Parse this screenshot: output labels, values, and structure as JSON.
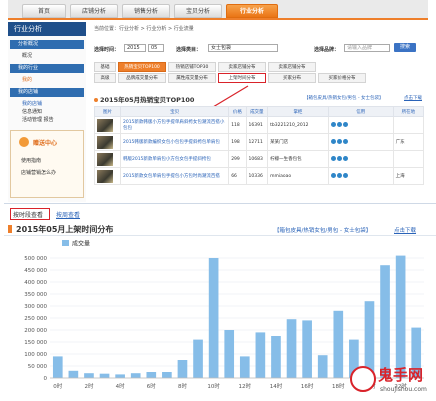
{
  "top_tabs": [
    "首页",
    "店铺分析",
    "销售分析",
    "宝贝分析",
    "行业分析"
  ],
  "active_top_tab": 4,
  "sidebar": {
    "header": "行业分析",
    "sections": [
      {
        "title": "分析概况",
        "items": [
          "概况"
        ]
      },
      {
        "title": "我的行业",
        "items": [
          "我的"
        ]
      },
      {
        "title": "我的店铺",
        "items": [
          "我的店铺",
          "信息通知",
          "活动管理 报告"
        ]
      }
    ],
    "service": {
      "title": "赠送中心",
      "items": [
        "使用指南",
        "店铺营销怎么办"
      ]
    }
  },
  "breadcrumb": "当前位置：行业分析 > 行业分析 > 行业流量",
  "filters": {
    "time_label": "选择时间：",
    "time_value": "2015",
    "month_value": "05",
    "category_label": "选择类目：",
    "category_value": "女士包袋",
    "brand_label": "选择品牌：",
    "brand_placeholder": "请输入品牌",
    "search_button": "搜索"
  },
  "subtabs_row1": [
    "热销宝贝TOP100",
    "热销店铺TOP30",
    "卖家店铺分布",
    "卖家店铺分布"
  ],
  "subtabs_row2": [
    "品牌成交量分布",
    "属性成交量分布",
    "上架时间分布",
    "买家分布",
    "买家价格分布"
  ],
  "section_title": "2015年05月热销宝贝TOP100",
  "section_links": "【箱包皮具/热销女包/男包 - 女士包袋】",
  "section_download": "点击下载",
  "table": {
    "headers": [
      "图片",
      "宝贝",
      "价格",
      "成交量",
      "掌柜",
      "信用",
      "所在地"
    ],
    "rows": [
      {
        "title": "2015新款韩版小方包手提单肩斜挎女包潮流百搭小包包",
        "price": "118",
        "sales": "16391",
        "seller": "tb3221210_2012",
        "location": ""
      },
      {
        "title": "2015韩版新款编织女包小包包手提斜挎包单肩包",
        "price": "198",
        "sales": "12711",
        "seller": "某某门店",
        "location": "广东"
      },
      {
        "title": "韩版2015新款单肩包小方包女包手提斜挎包",
        "price": "299",
        "sales": "10683",
        "seller": "柠檬一生香包包",
        "location": ""
      },
      {
        "title": "2015新款女包单肩包手提包小方包时尚潮流百搭",
        "price": "66",
        "sales": "10336",
        "seller": "mmiaoao",
        "location": "上海"
      }
    ]
  },
  "chart_tabs": [
    "按时段查看",
    "按周查看"
  ],
  "chart_header": "2015年05月上架时间分布",
  "chart_links": "【箱包皮具/热销女包/男包 - 女士包袋】",
  "chart_download": "点击下载",
  "watermark": {
    "brand": "鬼手网",
    "url": "shoujishou.com"
  },
  "chart_data": {
    "type": "bar",
    "title": "2015年05月上架时间分布",
    "legend": [
      "成交量"
    ],
    "categories": [
      "0时",
      "1时",
      "2时",
      "3时",
      "4时",
      "5时",
      "6时",
      "7时",
      "8时",
      "9时",
      "10时",
      "11时",
      "12时",
      "13时",
      "14时",
      "15时",
      "16时",
      "17时",
      "18时",
      "19时",
      "20时",
      "21时",
      "22时",
      "23时"
    ],
    "tick_labels": [
      "0时",
      "",
      "2时",
      "",
      "4时",
      "",
      "6时",
      "",
      "8时",
      "",
      "10时",
      "",
      "12时",
      "",
      "14时",
      "",
      "16时",
      "",
      "18时",
      "",
      "20时",
      "",
      "22时",
      ""
    ],
    "values": [
      90000,
      30000,
      20000,
      18000,
      15000,
      20000,
      25000,
      25000,
      75000,
      160000,
      500000,
      200000,
      90000,
      190000,
      175000,
      245000,
      240000,
      95000,
      280000,
      160000,
      320000,
      470000,
      510000,
      210000
    ],
    "ylim": [
      0,
      550000
    ],
    "yticks": [
      "0",
      "50 000",
      "100 000",
      "150 000",
      "200 000",
      "250 000",
      "300 000",
      "350 000",
      "400 000",
      "450 000",
      "500 000"
    ],
    "ytick_values": [
      0,
      50000,
      100000,
      150000,
      200000,
      250000,
      300000,
      350000,
      400000,
      450000,
      500000
    ],
    "colors": {
      "bar": "#86bde8",
      "grid": "#e3e8ef",
      "legend_box": "#86bde8"
    },
    "grid": true,
    "legend_position": "top-left"
  }
}
